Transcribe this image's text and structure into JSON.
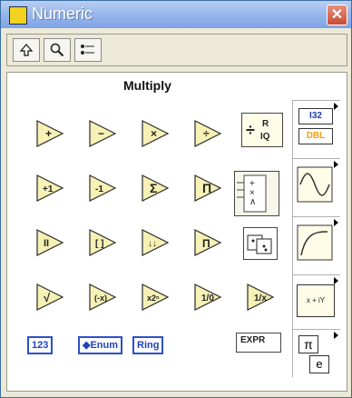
{
  "window": {
    "title": "Numeric"
  },
  "panel": {
    "title": "Multiply"
  },
  "grid": [
    {
      "label": "+"
    },
    {
      "label": "−"
    },
    {
      "label": "×"
    },
    {
      "label": "÷"
    },
    {
      "label": "+1"
    },
    {
      "label": "-1"
    },
    {
      "label": "Σ"
    },
    {
      "label": "Π"
    },
    {
      "label": "II"
    },
    {
      "label": "[ ]"
    },
    {
      "label": "↓↓"
    },
    {
      "label": "Π"
    },
    {
      "label": "√"
    },
    {
      "label": "(-x)"
    },
    {
      "label": "x2ⁿ"
    },
    {
      "label": "1/0"
    },
    {
      "label": "1/x"
    }
  ],
  "constants": {
    "numeric": "123",
    "enum": "◆Enum",
    "ring": "Ring",
    "expr": "EXPR"
  },
  "subpalette": {
    "i32": "I32",
    "dbl": "DBL",
    "pi": "π",
    "e": "e",
    "complex": "x + iY"
  },
  "colors": {
    "titlebar": "#8aaceb",
    "window": "#ece9d8"
  }
}
